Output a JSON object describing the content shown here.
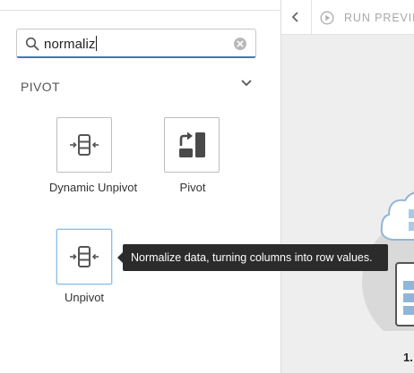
{
  "search": {
    "value": "normaliz"
  },
  "section": {
    "title": "PIVOT"
  },
  "tools": [
    {
      "label": "Dynamic Unpivot",
      "icon": "unpivot-icon"
    },
    {
      "label": "Pivot",
      "icon": "pivot-icon"
    },
    {
      "label": "Unpivot",
      "icon": "unpivot-icon"
    }
  ],
  "tooltip": {
    "text": "Normalize data, turning columns into row values."
  },
  "preview": {
    "run_label": "RUN PREVIEW",
    "step_number": "1."
  },
  "colors": {
    "accent": "#2f7fc1",
    "tooltip_bg": "#2b2b2b",
    "pivot_icon": "#4a4a4a"
  }
}
